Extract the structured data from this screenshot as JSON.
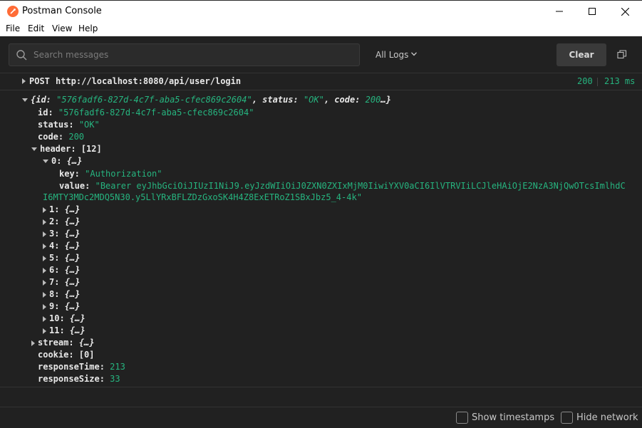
{
  "window": {
    "title": "Postman Console"
  },
  "menu": [
    "File",
    "Edit",
    "View",
    "Help"
  ],
  "toolbar": {
    "search_placeholder": "Search messages",
    "log_filter": "All Logs",
    "clear_label": "Clear"
  },
  "request": {
    "method": "POST",
    "url": "http://localhost:8080/api/user/login",
    "status": "200",
    "time": "213 ms"
  },
  "response": {
    "summary_id_key": "{id:",
    "summary_id_val": "\"576fadf6-827d-4c7f-aba5-cfec869c2604\"",
    "summary_status_key": ", status:",
    "summary_status_val": "\"OK\"",
    "summary_code_key": ", code:",
    "summary_code_val": "200",
    "summary_tail": "…}",
    "id_key": "id:",
    "id_val": "\"576fadf6-827d-4c7f-aba5-cfec869c2604\"",
    "status_key": "status:",
    "status_val": "\"OK\"",
    "code_key": "code:",
    "code_val": "200",
    "header_label": "header: [12]",
    "header0_label": "0:",
    "header0_brace": "{…}",
    "header0_key_key": "key:",
    "header0_key_val": "\"Authorization\"",
    "header0_value_key": "value:",
    "header0_value_line1": "\"Bearer eyJhbGciOiJIUzI1NiJ9.eyJzdWIiOiJ0ZXN0ZXIxMjM0IiwiYXV0aCI6IlVTRVIiLCJleHAiOjE2NzA3NjQwOTcsImlhdC",
    "header0_value_line2": "I6MTY3MDc2MDQ5N30.y5LlYRxBFLZDzGxoSK4H4Z8ExETRoZ1SBxJbz5_4-4k\"",
    "headers_collapsed": [
      {
        "index": "1:",
        "brace": "{…}"
      },
      {
        "index": "2:",
        "brace": "{…}"
      },
      {
        "index": "3:",
        "brace": "{…}"
      },
      {
        "index": "4:",
        "brace": "{…}"
      },
      {
        "index": "5:",
        "brace": "{…}"
      },
      {
        "index": "6:",
        "brace": "{…}"
      },
      {
        "index": "7:",
        "brace": "{…}"
      },
      {
        "index": "8:",
        "brace": "{…}"
      },
      {
        "index": "9:",
        "brace": "{…}"
      },
      {
        "index": "10:",
        "brace": "{…}"
      },
      {
        "index": "11:",
        "brace": "{…}"
      }
    ],
    "stream_key": "stream:",
    "stream_brace": "{…}",
    "cookie_label": "cookie: [0]",
    "responseTime_key": "responseTime:",
    "responseTime_val": "213",
    "responseSize_key": "responseSize:",
    "responseSize_val": "33"
  },
  "footer": {
    "show_timestamps": "Show timestamps",
    "hide_network": "Hide network"
  },
  "colors": {
    "accent": "#26b47f",
    "brand": "#ff6c37",
    "background": "#212121"
  }
}
